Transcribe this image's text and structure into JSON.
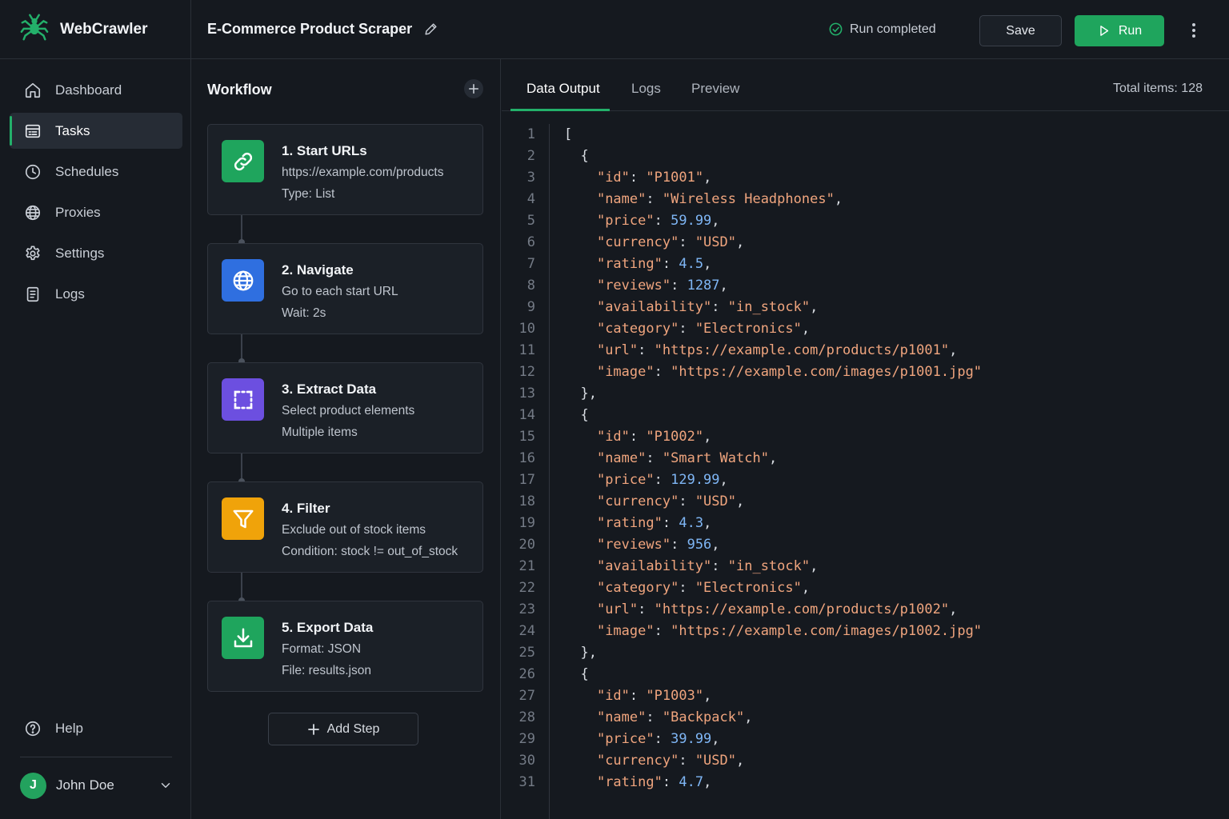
{
  "app": {
    "name": "WebCrawler"
  },
  "sidebar": {
    "items": [
      {
        "label": "Dashboard",
        "icon": "home-icon",
        "active": false
      },
      {
        "label": "Tasks",
        "icon": "tasks-icon",
        "active": true
      },
      {
        "label": "Schedules",
        "icon": "clock-icon",
        "active": false
      },
      {
        "label": "Proxies",
        "icon": "globe-icon",
        "active": false
      },
      {
        "label": "Settings",
        "icon": "gear-icon",
        "active": false
      },
      {
        "label": "Logs",
        "icon": "document-icon",
        "active": false
      }
    ],
    "help_label": "Help",
    "user": {
      "initial": "J",
      "name": "John Doe"
    }
  },
  "header": {
    "task_title": "E-Commerce Product Scraper",
    "status_text": "Run completed",
    "save_label": "Save",
    "run_label": "Run"
  },
  "workflow": {
    "title": "Workflow",
    "steps": [
      {
        "title": "1. Start URLs",
        "line1": "https://example.com/products",
        "line2": "Type: List",
        "icon": "link-icon",
        "color": "#1fa55d"
      },
      {
        "title": "2. Navigate",
        "line1": "Go to each start URL",
        "line2": "Wait: 2s",
        "icon": "globe-icon",
        "color": "#2f6fe0"
      },
      {
        "title": "3. Extract Data",
        "line1": "Select product elements",
        "line2": "Multiple items",
        "icon": "select-icon",
        "color": "#6c4fe0"
      },
      {
        "title": "4. Filter",
        "line1": "Exclude out of stock items",
        "line2": "Condition: stock != out_of_stock",
        "icon": "filter-icon",
        "color": "#f0a30a"
      },
      {
        "title": "5. Export Data",
        "line1": "Format: JSON",
        "line2": "File: results.json",
        "icon": "download-icon",
        "color": "#1fa55d"
      }
    ],
    "add_step_label": "Add Step"
  },
  "output": {
    "tabs": [
      "Data Output",
      "Logs",
      "Preview"
    ],
    "active_tab": "Data Output",
    "total_items": "Total items: 128",
    "code_lines": [
      "[",
      "  {",
      "    \"id\": \"P1001\",",
      "    \"name\": \"Wireless Headphones\",",
      "    \"price\": 59.99,",
      "    \"currency\": \"USD\",",
      "    \"rating\": 4.5,",
      "    \"reviews\": 1287,",
      "    \"availability\": \"in_stock\",",
      "    \"category\": \"Electronics\",",
      "    \"url\": \"https://example.com/products/p1001\",",
      "    \"image\": \"https://example.com/images/p1001.jpg\"",
      "  },",
      "  {",
      "    \"id\": \"P1002\",",
      "    \"name\": \"Smart Watch\",",
      "    \"price\": 129.99,",
      "    \"currency\": \"USD\",",
      "    \"rating\": 4.3,",
      "    \"reviews\": 956,",
      "    \"availability\": \"in_stock\",",
      "    \"category\": \"Electronics\",",
      "    \"url\": \"https://example.com/products/p1002\",",
      "    \"image\": \"https://example.com/images/p1002.jpg\"",
      "  },",
      "  {",
      "    \"id\": \"P1003\",",
      "    \"name\": \"Backpack\",",
      "    \"price\": 39.99,",
      "    \"currency\": \"USD\",",
      "    \"rating\": 4.7,"
    ]
  },
  "colors": {
    "accent": "#1fa55d",
    "background": "#15191f",
    "json_string": "#f0a57e",
    "json_number": "#7fb6f5"
  }
}
